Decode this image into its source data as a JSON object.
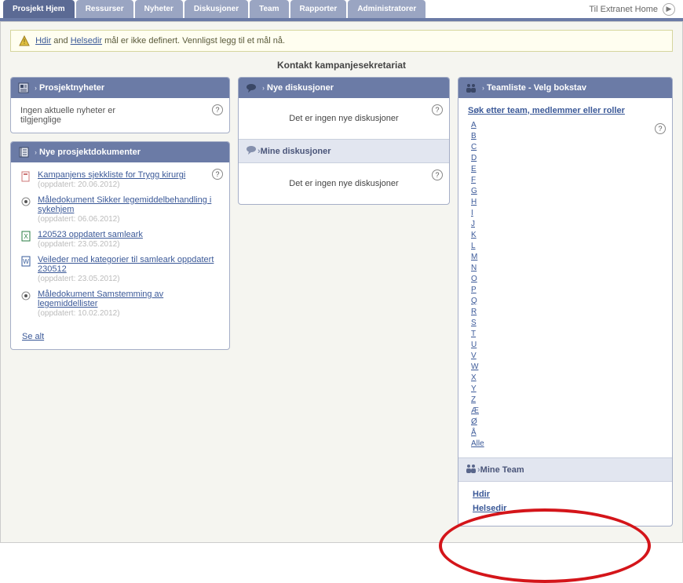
{
  "tabs": {
    "items": [
      "Prosjekt Hjem",
      "Ressurser",
      "Nyheter",
      "Diskusjoner",
      "Team",
      "Rapporter",
      "Administratorer"
    ],
    "active_index": 0
  },
  "extranet_link": "Til Extranet Home",
  "alert": {
    "link1": "Hdir",
    "and": " and ",
    "link2": "Helsedir",
    "text": " mål er ikke definert. Vennligst legg til et mål nå."
  },
  "section_title": "Kontakt kampanjesekretariat",
  "news": {
    "title": "Prosjektnyheter",
    "empty": "Ingen aktuelle nyheter er tilgjenglige"
  },
  "docs": {
    "title": "Nye prosjektdokumenter",
    "items": [
      {
        "label": "Kampanjens sjekkliste for Trygg kirurgi",
        "meta": "(oppdatert: 20.06.2012)"
      },
      {
        "label": "Måledokument Sikker legemiddelbehandling i sykehjem",
        "meta": "(oppdatert: 06.06.2012)"
      },
      {
        "label": "120523 oppdatert samleark",
        "meta": "(oppdatert: 23.05.2012)"
      },
      {
        "label": "Veileder med kategorier til samleark oppdatert 230512",
        "meta": "(oppdatert: 23.05.2012)"
      },
      {
        "label": "Måledokument Samstemming av legemiddellister",
        "meta": "(oppdatert: 10.02.2012)"
      }
    ],
    "see_all": "Se alt"
  },
  "discussions": {
    "title_new": "Nye diskusjoner",
    "empty": "Det er ingen nye diskusjoner",
    "title_mine": "Mine diskusjoner"
  },
  "teamlist": {
    "title": "Teamliste - Velg bokstav",
    "search_link": "Søk etter team, medlemmer eller roller",
    "letters": [
      "A",
      "B",
      "C",
      "D",
      "E",
      "F",
      "G",
      "H",
      "I",
      "J",
      "K",
      "L",
      "M",
      "N",
      "O",
      "P",
      "Q",
      "R",
      "S",
      "T",
      "U",
      "V",
      "W",
      "X",
      "Y",
      "Z",
      "Æ",
      "Ø",
      "Å",
      "Alle"
    ]
  },
  "mineteam": {
    "title": "Mine Team",
    "items": [
      "Hdir",
      "Helsedir"
    ]
  }
}
